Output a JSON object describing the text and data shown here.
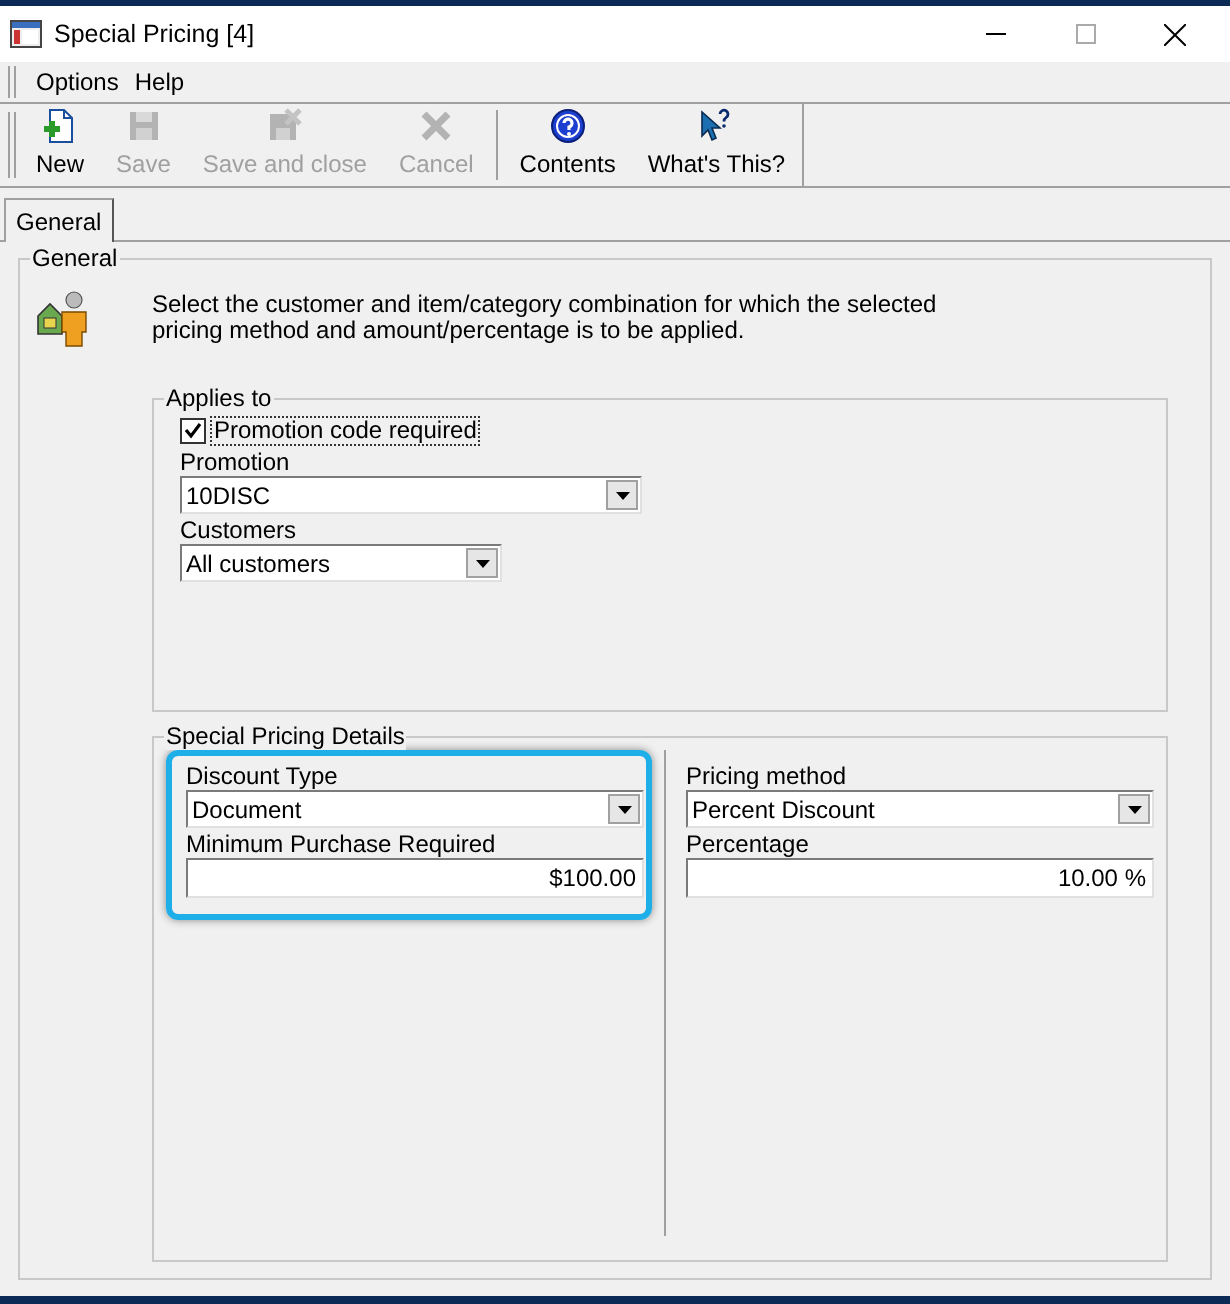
{
  "window": {
    "title": "Special Pricing [4]"
  },
  "menu": [
    "Options",
    "Help"
  ],
  "toolbar": [
    {
      "label": "New",
      "disabled": false
    },
    {
      "label": "Save",
      "disabled": true
    },
    {
      "label": "Save and close",
      "disabled": true
    },
    {
      "label": "Cancel",
      "disabled": true
    },
    {
      "label": "Contents",
      "disabled": false
    },
    {
      "label": "What's This?",
      "disabled": false
    }
  ],
  "tabs": [
    {
      "label": "General",
      "selected": true
    }
  ],
  "general": {
    "title": "General",
    "description": "Select the customer and item/category combination for which the selected pricing method and amount/percentage is to be applied.",
    "applies_to": {
      "title": "Applies to",
      "promotion_code_required": {
        "label": "Promotion code required",
        "checked": true
      },
      "fields": [
        {
          "label": "Promotion",
          "value": "10DISC",
          "kind": "combo"
        },
        {
          "label": "Customers",
          "value": "All customers",
          "kind": "combo"
        }
      ]
    },
    "details": {
      "title": "Special Pricing Details",
      "left": {
        "highlighted": true,
        "fields": [
          {
            "label": "Discount Type",
            "value": "Document",
            "kind": "combo"
          },
          {
            "label": "Minimum Purchase Required",
            "value": "$100.00",
            "kind": "number"
          }
        ]
      },
      "right": {
        "fields": [
          {
            "label": "Pricing method",
            "value": "Percent Discount",
            "kind": "combo"
          },
          {
            "label": "Percentage",
            "value": "10.00 %",
            "kind": "number"
          }
        ]
      }
    }
  }
}
